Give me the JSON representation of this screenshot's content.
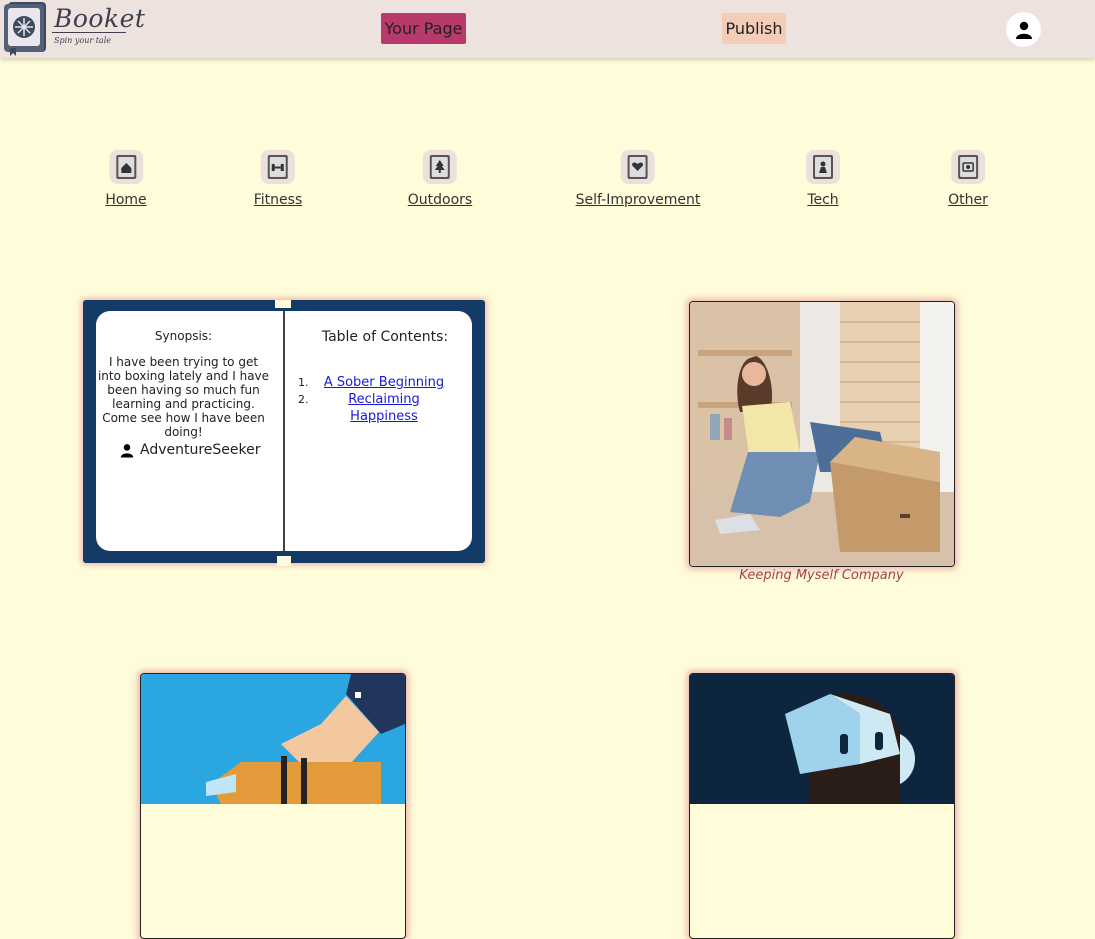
{
  "header": {
    "logo_text": "Booket",
    "logo_tagline": "Spin your tale",
    "your_page_label": "Your Page",
    "publish_label": "Publish",
    "profile_icon": "user-icon"
  },
  "categories": [
    {
      "label": "Home",
      "icon": "house-icon"
    },
    {
      "label": "Fitness",
      "icon": "dumbbell-icon"
    },
    {
      "label": "Outdoors",
      "icon": "tree-icon"
    },
    {
      "label": "Self-Improvement",
      "icon": "heart-icon"
    },
    {
      "label": "Tech",
      "icon": "robot-icon"
    },
    {
      "label": "Other",
      "icon": "misc-icon"
    }
  ],
  "featured_book": {
    "synopsis_label": "Synopsis:",
    "synopsis": "I have been trying to get into boxing lately and I have been having so much fun learning and practicing. Come see how I have been doing!",
    "author": "AdventureSeeker",
    "toc_title": "Table of Contents:",
    "toc": [
      {
        "number": "1.",
        "title": "A Sober Beginning"
      },
      {
        "number": "2.",
        "title": "Reclaiming Happiness"
      }
    ]
  },
  "cards": [
    {
      "caption": "Keeping Myself Company",
      "image": "woman unpacking clothes from a box"
    },
    {
      "caption": "",
      "image": "hand pouring a drink"
    },
    {
      "caption": "",
      "image": "man wearing VR headset"
    }
  ],
  "colors": {
    "page_bg": "#fffcd9",
    "header_bg": "#ede2dd",
    "your_page_btn": "#b83a6a",
    "publish_btn": "#f3cdb8",
    "book_cover": "#143a66",
    "caption": "#a5404f",
    "link": "#1a1ad6"
  }
}
